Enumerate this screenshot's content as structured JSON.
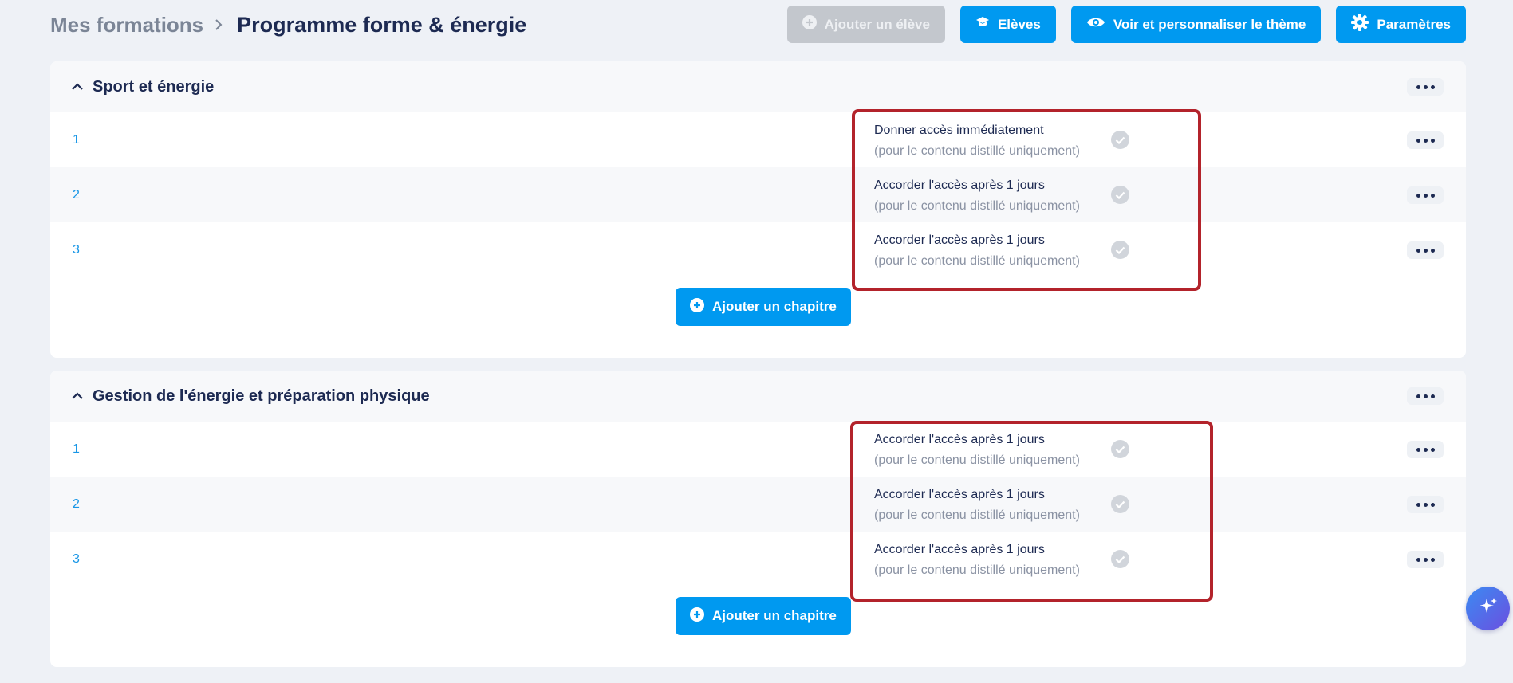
{
  "breadcrumb": {
    "root": "Mes formations",
    "current": "Programme forme & énergie"
  },
  "toolbar": {
    "add_student": "Ajouter un élève",
    "students": "Elèves",
    "theme": "Voir et personnaliser le thème",
    "settings": "Paramètres"
  },
  "colors": {
    "accent": "#0099f0",
    "disabled": "#c3c7cd",
    "highlight": "#b3232b",
    "background": "#eef1f6"
  },
  "sections": [
    {
      "title": "Sport et énergie",
      "add_chapter": "Ajouter un chapitre",
      "rows": [
        {
          "number": "1",
          "access": "Donner accès immédiatement",
          "note": "(pour le contenu distillé uniquement)"
        },
        {
          "number": "2",
          "access": "Accorder l'accès après 1 jours",
          "note": "(pour le contenu distillé uniquement)"
        },
        {
          "number": "3",
          "access": "Accorder l'accès après 1 jours",
          "note": "(pour le contenu distillé uniquement)"
        }
      ]
    },
    {
      "title": "Gestion de l'énergie et préparation physique",
      "add_chapter": "Ajouter un chapitre",
      "rows": [
        {
          "number": "1",
          "access": "Accorder l'accès après 1 jours",
          "note": "(pour le contenu distillé uniquement)"
        },
        {
          "number": "2",
          "access": "Accorder l'accès après 1 jours",
          "note": "(pour le contenu distillé uniquement)"
        },
        {
          "number": "3",
          "access": "Accorder l'accès après 1 jours",
          "note": "(pour le contenu distillé uniquement)"
        }
      ]
    }
  ],
  "icons": {
    "breadcrumb_separator": "chevron-right-icon",
    "add_student": "plus-circle-icon",
    "students": "graduation-cap-icon",
    "theme": "eye-icon",
    "settings": "gear-icon",
    "collapse": "chevron-up-icon",
    "more": "more-dots-icon",
    "check": "check-circle-icon",
    "add_chapter": "plus-circle-icon",
    "assistant": "sparkle-icon"
  }
}
